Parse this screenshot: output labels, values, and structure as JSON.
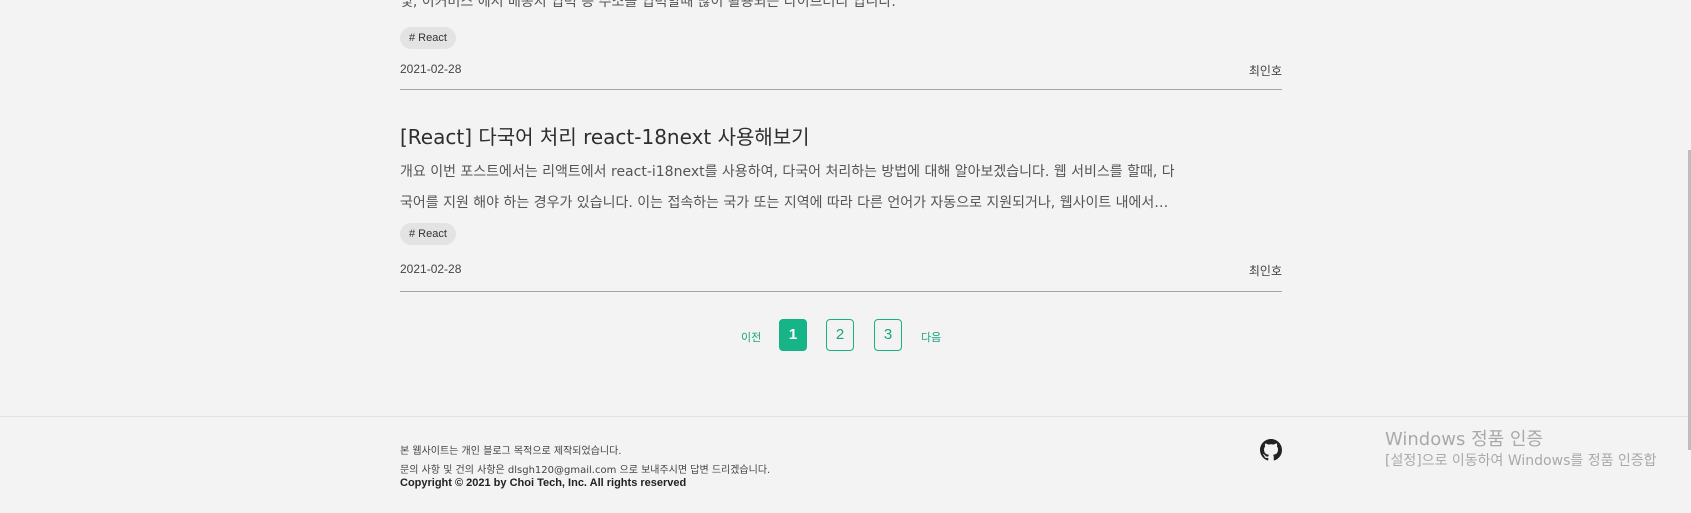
{
  "posts": [
    {
      "description_partial": "및, 이커머스 에서 배송지 입력 등 주소를 입력할때 많이 활용되는 라이브러리 입니다.",
      "tag": "# React",
      "date": "2021-02-28",
      "author": "최인호"
    },
    {
      "title": "[React] 다국어 처리 react-18next 사용해보기",
      "description_line1": "개요 이번 포스트에서는 리액트에서 react-i18next를 사용하여, 다국어 처리하는 방법에 대해 알아보겠습니다. 웹 서비스를 할때, 다",
      "description_line2": "국어를 지원 해야 하는 경우가 있습니다. 이는 접속하는 국가 또는 지역에 따라 다른 언어가 자동으로 지원되거나, 웹사이트 내에서…",
      "tag": "# React",
      "date": "2021-02-28",
      "author": "최인호"
    }
  ],
  "pagination": {
    "prev_label": "이전",
    "next_label": "다음",
    "pages": [
      "1",
      "2",
      "3"
    ],
    "current": "1"
  },
  "footer": {
    "line1": "본 웹사이트는 개인 블로그 목적으로 제작되었습니다.",
    "line2": "문의 사항 및 건의 사항은 dlsgh120@gmail.com 으로 보내주시면 답변 드리겠습니다.",
    "copyright": "Copyright © 2021 by Choi Tech, Inc. All rights reserved",
    "github_icon": "github-icon"
  },
  "windows_watermark": {
    "title": "Windows 정품 인증",
    "subtitle": "[설정]으로 이동하여 Windows를 정품 인증합"
  },
  "colors": {
    "accent": "#17b487",
    "background": "#f3f3f3",
    "divider": "#a6a6a6"
  }
}
